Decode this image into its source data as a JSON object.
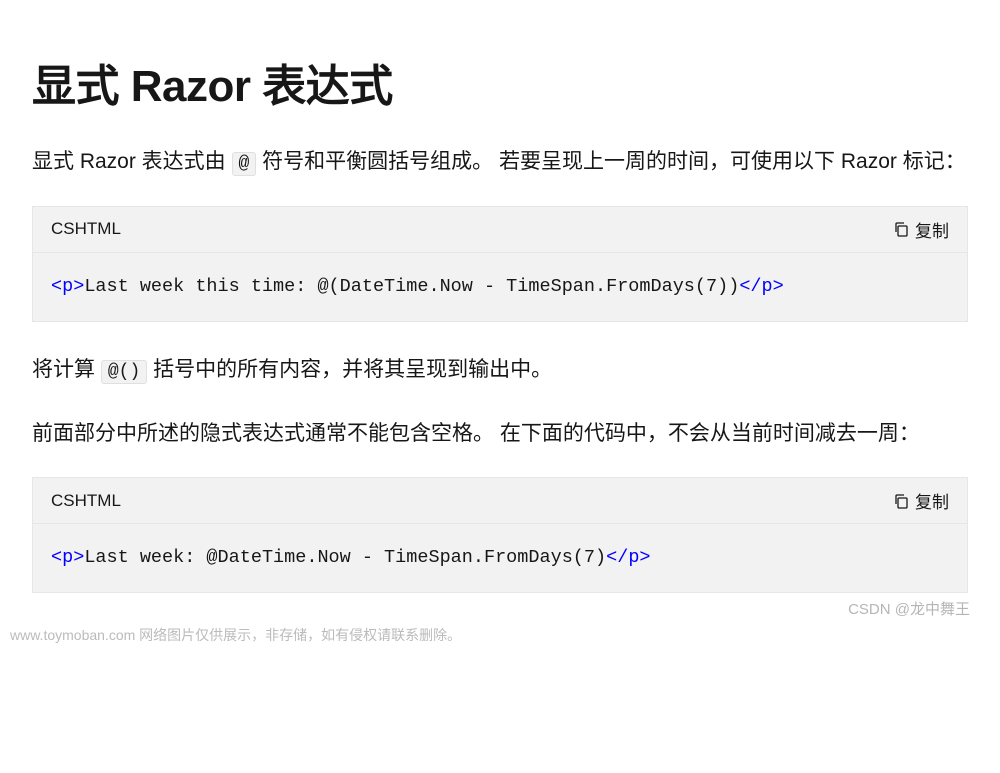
{
  "heading": "显式 Razor 表达式",
  "paragraphs": {
    "p1_before": "显式 Razor 表达式由 ",
    "p1_code": "@",
    "p1_after": " 符号和平衡圆括号组成。 若要呈现上一周的时间，可使用以下 Razor 标记：",
    "p2_before": "将计算 ",
    "p2_code": "@()",
    "p2_after": " 括号中的所有内容，并将其呈现到输出中。",
    "p3": "前面部分中所述的隐式表达式通常不能包含空格。 在下面的代码中，不会从当前时间减去一周："
  },
  "codeBlocks": {
    "block1": {
      "lang": "CSHTML",
      "copyLabel": "复制",
      "tag_open": "<p>",
      "content": "Last week this time: @(DateTime.Now - TimeSpan.FromDays(7))",
      "tag_close": "</p>"
    },
    "block2": {
      "lang": "CSHTML",
      "copyLabel": "复制",
      "tag_open": "<p>",
      "content": "Last week: @DateTime.Now - TimeSpan.FromDays(7)",
      "tag_close": "</p>"
    }
  },
  "watermarks": {
    "right": "CSDN @龙中舞王",
    "left": "www.toymoban.com 网络图片仅供展示，非存储，如有侵权请联系删除。"
  }
}
